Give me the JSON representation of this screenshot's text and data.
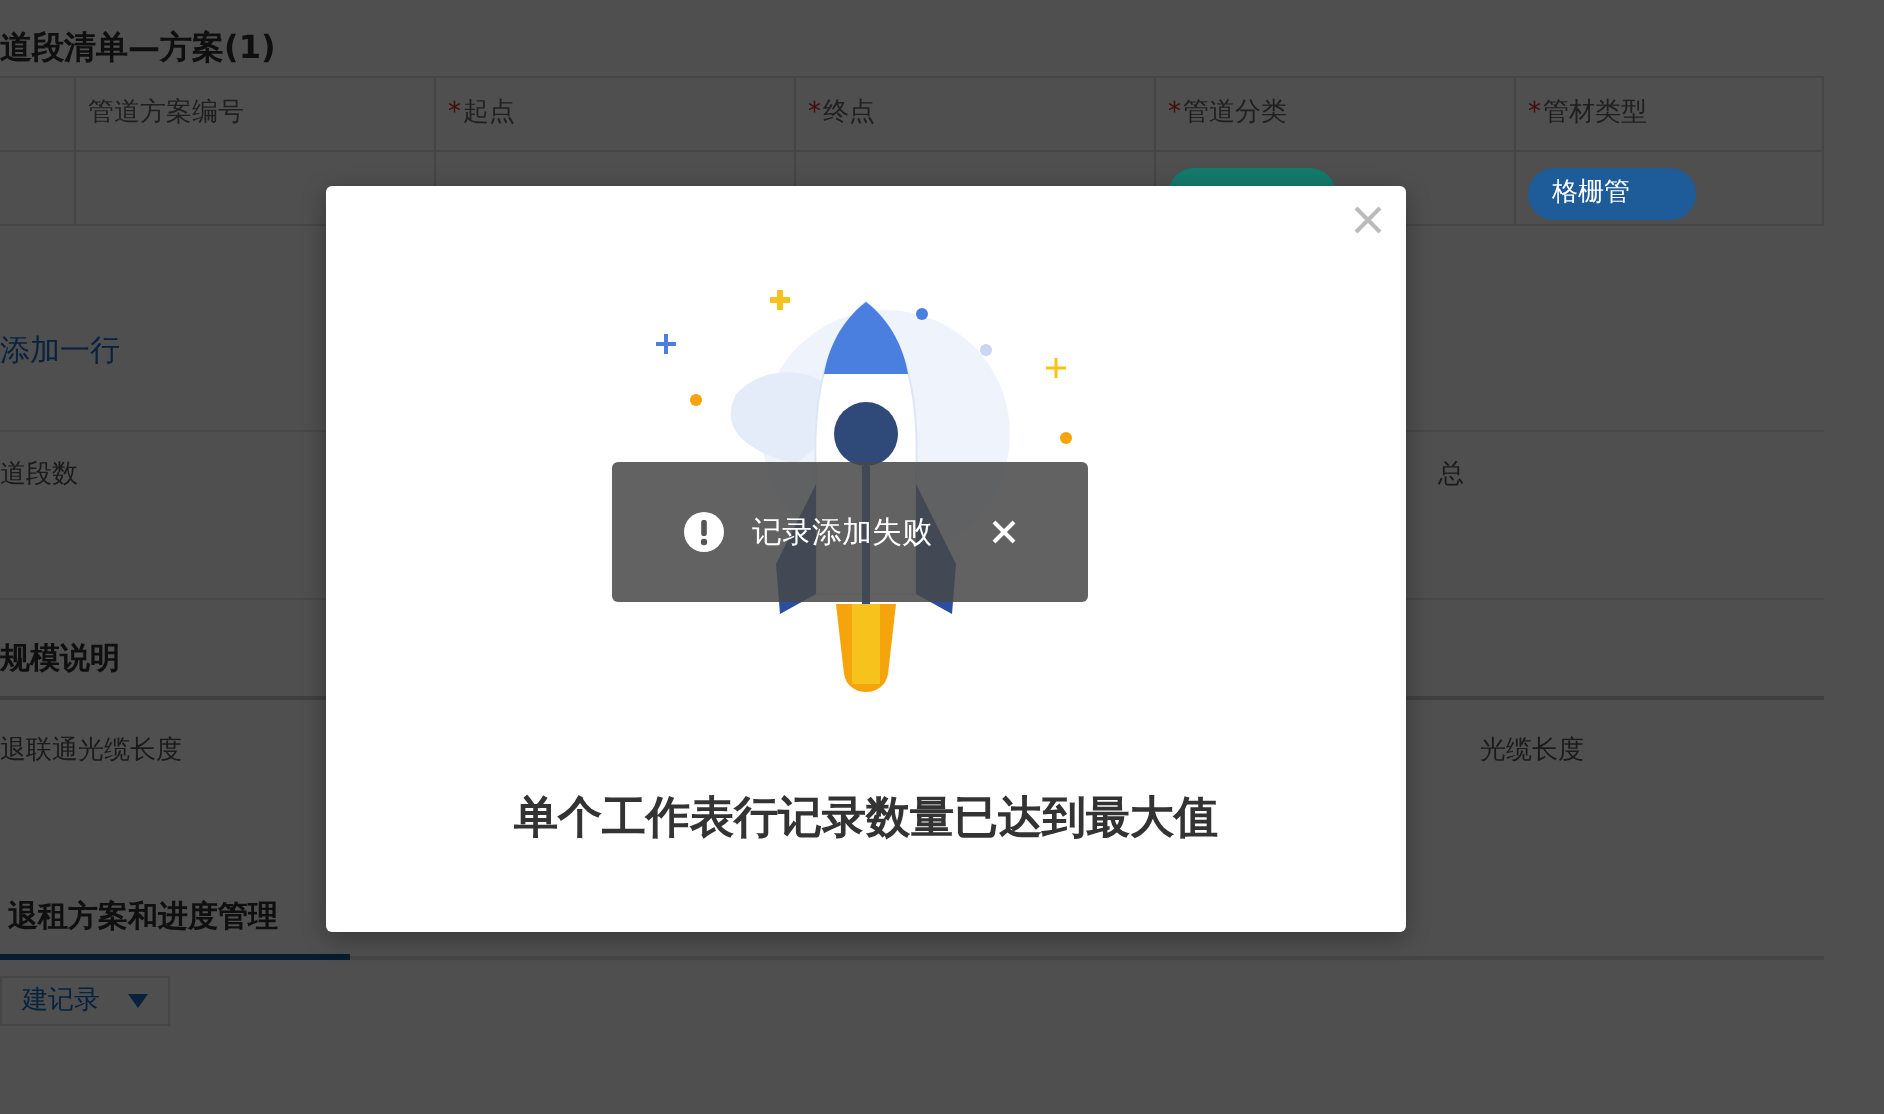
{
  "section_title": "道段清单—方案(1)",
  "table": {
    "required_mark": "*",
    "columns": [
      {
        "label": "管道方案编号",
        "required": false
      },
      {
        "label": "起点",
        "required": true
      },
      {
        "label": "终点",
        "required": true
      },
      {
        "label": "管道分类",
        "required": true
      },
      {
        "label": "管材类型",
        "required": true
      }
    ],
    "row": [
      {
        "kind": "empty"
      },
      {
        "kind": "empty"
      },
      {
        "kind": "empty"
      },
      {
        "kind": "tag",
        "color": "#127a6c"
      },
      {
        "kind": "tag",
        "text": "格栅管",
        "color": "#1d5c99"
      }
    ]
  },
  "add_row_link": "添加一行",
  "summary_fields": [
    {
      "label": "道段数"
    },
    {
      "label": "总"
    }
  ],
  "scale_section": {
    "title": "规模说明",
    "fields": [
      {
        "label": "退联通光缆长度"
      },
      {
        "label": "光缆长度"
      }
    ]
  },
  "tabs": [
    {
      "label": "退租方案和进度管理",
      "selected": true
    }
  ],
  "new_record_button": {
    "label": "建记录"
  },
  "dialog": {
    "message": "单个工作表行记录数量已达到最大值"
  },
  "toast": {
    "text": "记录添加失败"
  }
}
